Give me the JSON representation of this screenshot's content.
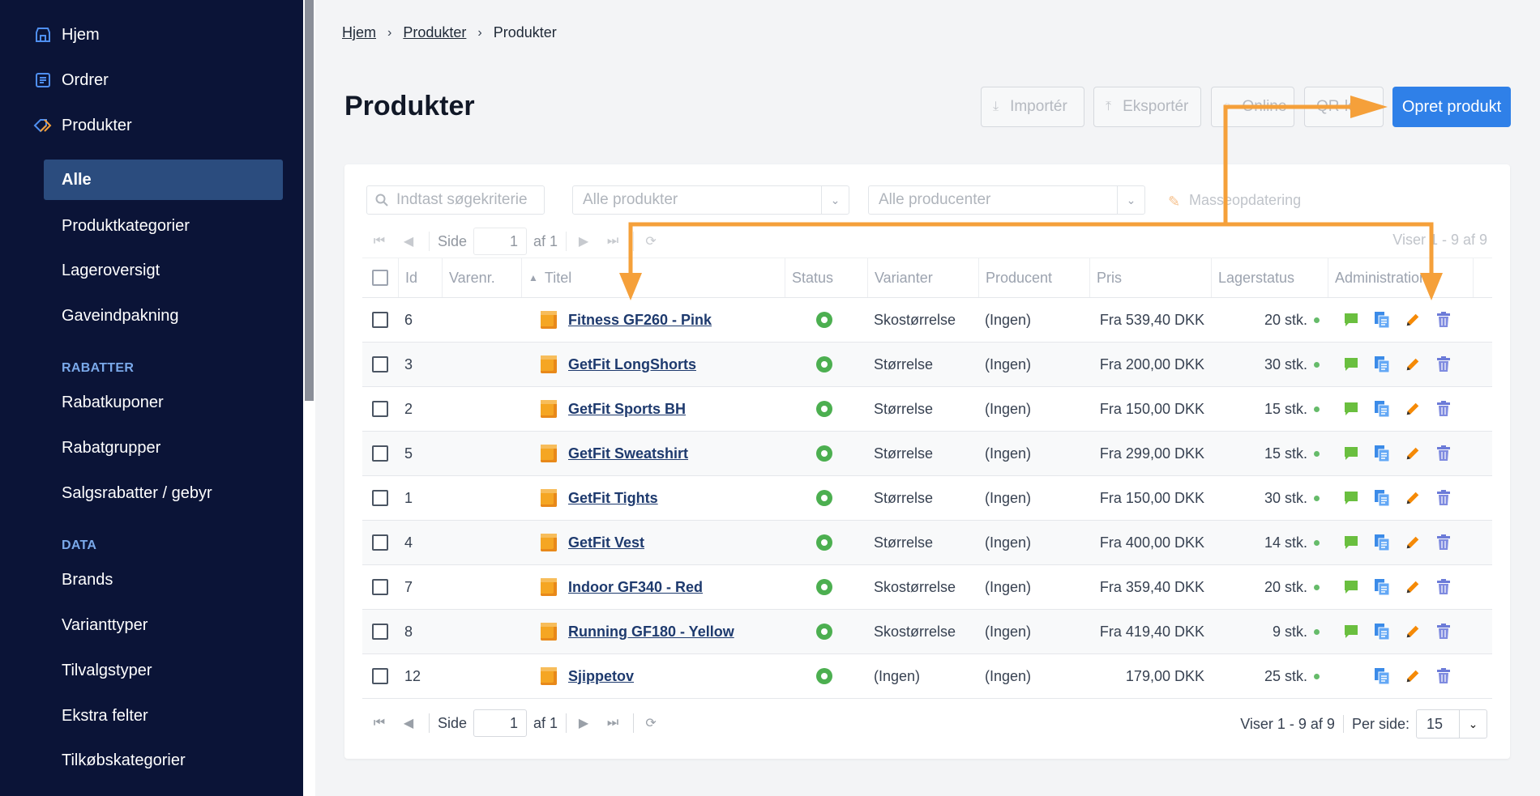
{
  "sidebar": {
    "top_items": [
      {
        "label": "Hjem",
        "icon": "store-icon"
      },
      {
        "label": "Ordrer",
        "icon": "list-icon"
      },
      {
        "label": "Produkter",
        "icon": "tag-icon"
      }
    ],
    "product_items": [
      "Alle",
      "Produktkategorier",
      "Lageroversigt",
      "Gaveindpakning"
    ],
    "sections": [
      {
        "heading": "RABATTER",
        "items": [
          "Rabatkuponer",
          "Rabatgrupper",
          "Salgsrabatter / gebyr"
        ]
      },
      {
        "heading": "DATA",
        "items": [
          "Brands",
          "Varianttyper",
          "Tilvalgstyper",
          "Ekstra felter",
          "Tilkøbskategorier"
        ]
      }
    ]
  },
  "breadcrumb": [
    "Hjem",
    "Produkter",
    "Produkter"
  ],
  "page_title": "Produkter",
  "toolbar": {
    "import_label": "Importér",
    "export_label": "Eksportér",
    "online_label": "Online",
    "qr_label": "QR-k",
    "create_label": "Opret produkt"
  },
  "filters": {
    "search_placeholder": "Indtast søgekriterie",
    "products_select": "Alle produkter",
    "producers_select": "Alle producenter",
    "mass_update": "Masseopdatering"
  },
  "pager": {
    "page_label": "Side",
    "page_value": "1",
    "of_label": "af 1",
    "showing": "Viser 1 - 9 af 9",
    "per_page_label": "Per side:",
    "per_page_value": "15"
  },
  "columns": [
    "Id",
    "Varenr.",
    "Titel",
    "Status",
    "Varianter",
    "Producent",
    "Pris",
    "Lagerstatus",
    "Administration"
  ],
  "rows": [
    {
      "id": "6",
      "title": "Fitness GF260 - Pink",
      "variants": "Skostørrelse",
      "producer": "(Ingen)",
      "price": "Fra 539,40 DKK",
      "stock": "20 stk.",
      "comment": true
    },
    {
      "id": "3",
      "title": "GetFit LongShorts",
      "variants": "Størrelse",
      "producer": "(Ingen)",
      "price": "Fra 200,00 DKK",
      "stock": "30 stk.",
      "comment": true
    },
    {
      "id": "2",
      "title": "GetFit Sports BH",
      "variants": "Størrelse",
      "producer": "(Ingen)",
      "price": "Fra 150,00 DKK",
      "stock": "15 stk.",
      "comment": true
    },
    {
      "id": "5",
      "title": "GetFit Sweatshirt",
      "variants": "Størrelse",
      "producer": "(Ingen)",
      "price": "Fra 299,00 DKK",
      "stock": "15 stk.",
      "comment": true
    },
    {
      "id": "1",
      "title": "GetFit Tights",
      "variants": "Størrelse",
      "producer": "(Ingen)",
      "price": "Fra 150,00 DKK",
      "stock": "30 stk.",
      "comment": true
    },
    {
      "id": "4",
      "title": "GetFit Vest",
      "variants": "Størrelse",
      "producer": "(Ingen)",
      "price": "Fra 400,00 DKK",
      "stock": "14 stk.",
      "comment": true
    },
    {
      "id": "7",
      "title": "Indoor GF340 - Red",
      "variants": "Skostørrelse",
      "producer": "(Ingen)",
      "price": "Fra 359,40 DKK",
      "stock": "20 stk.",
      "comment": true
    },
    {
      "id": "8",
      "title": "Running GF180 - Yellow",
      "variants": "Skostørrelse",
      "producer": "(Ingen)",
      "price": "Fra 419,40 DKK",
      "stock": "9 stk.",
      "comment": true
    },
    {
      "id": "12",
      "title": "Sjippetov",
      "variants": "(Ingen)",
      "producer": "(Ingen)",
      "price": "179,00 DKK",
      "stock": "25 stk.",
      "comment": false
    }
  ],
  "colors": {
    "sidebar_bg": "#0b1437",
    "accent": "#2f80e8",
    "arrow": "#f5a03a",
    "status_green": "#4caf50"
  }
}
